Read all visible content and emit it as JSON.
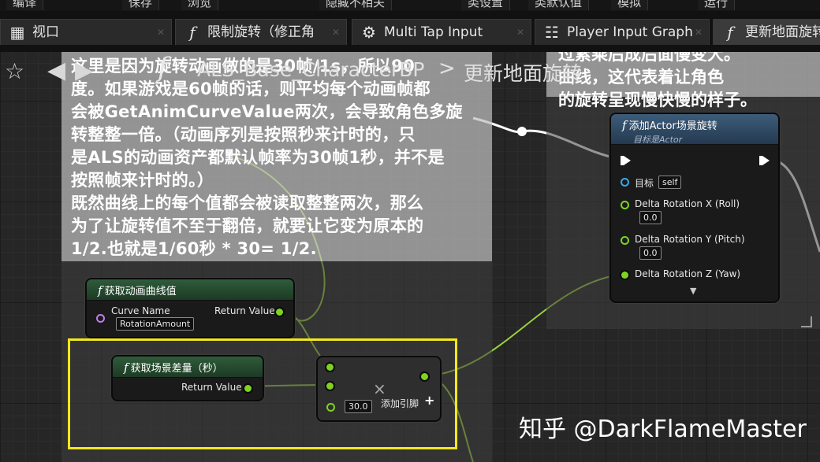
{
  "menu": {
    "items": [
      "编译",
      "保存",
      "浏览",
      "隐藏不相关",
      "类设置",
      "类默认值",
      "模拟",
      "运行"
    ]
  },
  "tabs": [
    {
      "label": "视口",
      "icon": "viewport-icon"
    },
    {
      "label": "限制旋转（修正角",
      "icon": "function-icon"
    },
    {
      "label": "Multi Tap Input",
      "icon": "gear-icon"
    },
    {
      "label": "Player Input Graph",
      "icon": "graph-icon"
    },
    {
      "label": "更新地面旋转",
      "icon": "function-icon",
      "active": true
    }
  ],
  "breadcrumb": {
    "func_glyph": "f",
    "blueprint": "ALS_Base_CharacterBP",
    "separator": ">",
    "function": "更新地面旋转"
  },
  "comments": {
    "left_lines": [
      "这里是因为旋转动画做的是30帧/1s，所以90",
      "度。如果游戏是60帧的话，则平均每个动画帧都",
      "会被GetAnimCurveValue两次，会导致角色多旋",
      "转整整一倍。（动画序列是按照秒来计时的，只",
      "是ALS的动画资产都默认帧率为30帧1秒，并不是",
      "按照帧来计时的。）",
      "既然曲线上的每个值都会被读取整整两次，那么",
      "为了让旋转值不至于翻倍，就要让它变为原本的",
      "1/2.也就是1/60秒 * 30= 1/2."
    ],
    "right_lines": [
      "过累乘后成后面慢变大。",
      "曲线，这代表着让角色",
      "的旋转呈现慢快慢的样子。"
    ]
  },
  "nodes": {
    "add_rotation": {
      "title": "添加Actor场景旋转",
      "subtitle": "目标是Actor",
      "target_label": "目标",
      "target_value": "self",
      "pins": [
        {
          "label": "Delta Rotation X (Roll)",
          "value": "0.0"
        },
        {
          "label": "Delta Rotation Y (Pitch)",
          "value": "0.0"
        },
        {
          "label": "Delta Rotation Z (Yaw)",
          "value": ""
        }
      ]
    },
    "get_curve": {
      "title": "获取动画曲线值",
      "in_label": "Curve Name",
      "in_value": "RotationAmount",
      "out_label": "Return Value"
    },
    "get_delta": {
      "title": "获取场景差量（秒）",
      "out_label": "Return Value"
    },
    "multiply": {
      "symbol": "×",
      "value": "30.0",
      "add_pin_label": "添加引脚",
      "add_symbol": "+"
    }
  },
  "watermark": "知乎 @DarkFlameMaster",
  "colors": {
    "highlight": "#f2e81c",
    "float_pin": "#7ed321",
    "object_pin": "#3aa7e8",
    "name_pin": "#c07cf0"
  }
}
